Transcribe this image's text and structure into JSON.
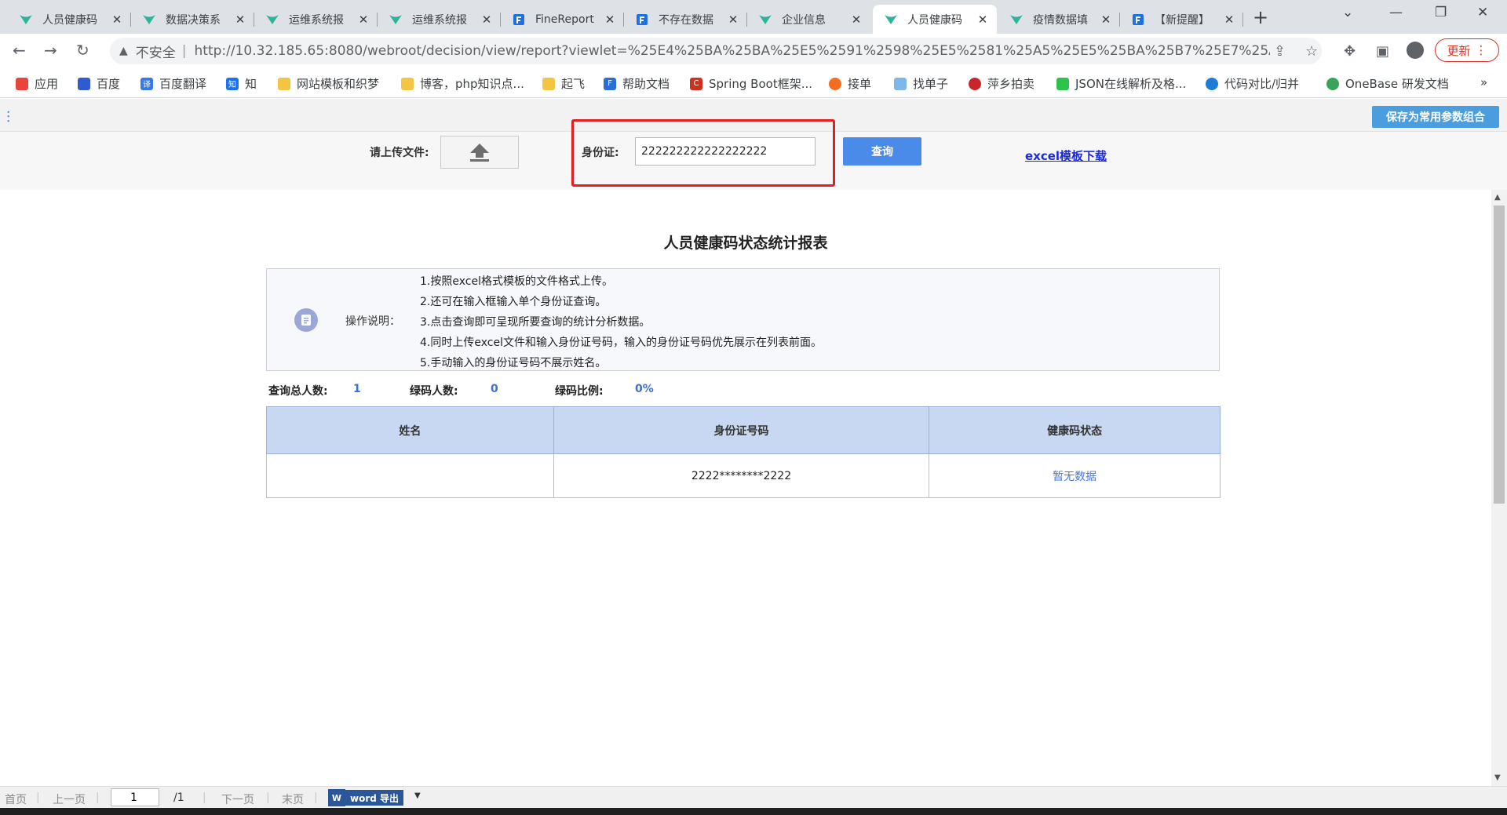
{
  "browser": {
    "tabs": [
      {
        "title": "人员健康码",
        "icon": "fr-leaf-icon",
        "active": false
      },
      {
        "title": "数据决策系",
        "icon": "fr-leaf-icon",
        "active": false
      },
      {
        "title": "运维系统报",
        "icon": "fr-leaf-icon",
        "active": false
      },
      {
        "title": "运维系统报",
        "icon": "fr-leaf-icon",
        "active": false
      },
      {
        "title": "FineReport",
        "icon": "finereport-icon",
        "active": false
      },
      {
        "title": "不存在数据",
        "icon": "finereport-icon",
        "active": false
      },
      {
        "title": "企业信息",
        "icon": "fr-leaf-icon",
        "active": false
      },
      {
        "title": "人员健康码",
        "icon": "fr-leaf-icon",
        "active": true
      },
      {
        "title": "疫情数据填",
        "icon": "fr-leaf-icon",
        "active": false
      },
      {
        "title": "【新提醒】",
        "icon": "finereport-icon",
        "active": false
      }
    ],
    "address": {
      "security": "不安全",
      "url": "http://10.32.185.65:8080/webroot/decision/view/report?viewlet=%25E4%25BA%25BA%25E5%2591%2598%25E5%2581%25A5%25E5%25BA%25B7%25E7%25A..."
    },
    "update_label": "更新",
    "bookmarks": [
      {
        "label": "应用",
        "color": "#e8453c"
      },
      {
        "label": "百度",
        "color": "#2f5bd1"
      },
      {
        "label": "百度翻译",
        "color": "#3778e8"
      },
      {
        "label": "知",
        "color": "#1772f6"
      },
      {
        "label": "网站模板和织梦",
        "color": "#f4c542"
      },
      {
        "label": "博客，php知识点...",
        "color": "#f4c542"
      },
      {
        "label": "起飞",
        "color": "#f4c542"
      },
      {
        "label": "帮助文档",
        "color": "#2b6fd6"
      },
      {
        "label": "Spring Boot框架...",
        "color": "#d0311f"
      },
      {
        "label": "接单",
        "color": "#f36c21"
      },
      {
        "label": "找单子",
        "color": "#7db9e8"
      },
      {
        "label": "萍乡拍卖",
        "color": "#c9252c"
      },
      {
        "label": "JSON在线解析及格...",
        "color": "#2ec44b"
      },
      {
        "label": "代码对比/归并",
        "color": "#1e7bd6"
      },
      {
        "label": "OneBase 研发文档",
        "color": "#3aa35b"
      }
    ],
    "bookmarks_overflow": "»"
  },
  "toolbar": {
    "save_combo_label": "保存为常用参数组合"
  },
  "params": {
    "upload_label": "请上传文件:",
    "id_label": "身份证:",
    "id_value": "222222222222222222",
    "query_label": "查询",
    "excel_link": "excel模板下载"
  },
  "report": {
    "title": "人员健康码状态统计报表",
    "instructions_label": "操作说明：",
    "instructions": [
      "1.按照excel格式模板的文件格式上传。",
      "2.还可在输入框输入单个身份证查询。",
      "3.点击查询即可呈现所要查询的统计分析数据。",
      "4.同时上传excel文件和输入身份证号码，输入的身份证号码优先展示在列表前面。",
      "5.手动输入的身份证号码不展示姓名。"
    ],
    "stats": {
      "total_label": "查询总人数:",
      "total_value": "1",
      "green_label": "绿码人数:",
      "green_value": "0",
      "ratio_label": "绿码比例:",
      "ratio_value": "0%"
    },
    "table": {
      "headers": [
        "姓名",
        "身份证号码",
        "健康码状态"
      ],
      "rows": [
        {
          "name": "",
          "id": "2222********2222",
          "status": "暂无数据"
        }
      ]
    }
  },
  "pager": {
    "first": "首页",
    "prev": "上一页",
    "page": "1",
    "total": "/1",
    "next": "下一页",
    "last": "末页",
    "word_export": "word 导出"
  },
  "colors": {
    "accent": "#4a8bea",
    "highlight_frame": "#e02020",
    "header_fill": "#c8d8f2",
    "link": "#1d2be0"
  }
}
